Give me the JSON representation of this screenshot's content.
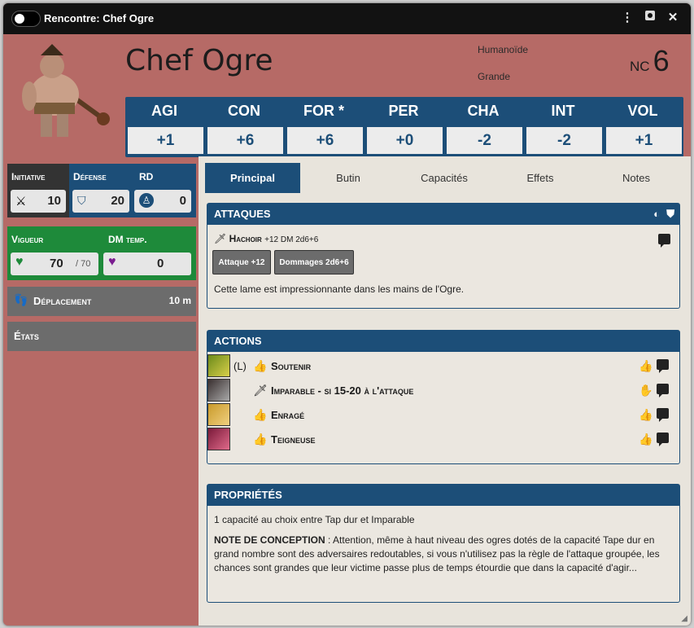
{
  "window": {
    "title": "Rencontre: Chef Ogre"
  },
  "header": {
    "name": "Chef Ogre",
    "type": "Humanoïde",
    "size": "Grande",
    "nc_label": "NC",
    "nc_value": "6"
  },
  "stats": [
    {
      "name": "AGI",
      "value": "+1"
    },
    {
      "name": "CON",
      "value": "+6"
    },
    {
      "name": "FOR *",
      "value": "+6"
    },
    {
      "name": "PER",
      "value": "+0"
    },
    {
      "name": "CHA",
      "value": "-2"
    },
    {
      "name": "INT",
      "value": "-2"
    },
    {
      "name": "VOL",
      "value": "+1"
    }
  ],
  "combat": {
    "initiative_label": "Initiative",
    "initiative": "10",
    "defense_label": "Défense",
    "defense": "20",
    "rd_label": "RD",
    "rd": "0",
    "vigueur_label": "Vigueur",
    "vigueur": "70",
    "vigueur_max": "/ 70",
    "dmtemp_label": "DM temp.",
    "dmtemp": "0",
    "deplacement_label": "Déplacement",
    "deplacement": "10 m",
    "etats_label": "États"
  },
  "tabs": [
    "Principal",
    "Butin",
    "Capacités",
    "Effets",
    "Notes"
  ],
  "attaques": {
    "title": "ATTAQUES",
    "weapon": "Hachoir",
    "weapon_stats": "+12 DM 2d6+6",
    "attack_button": "Attaque +12",
    "damage_button": "Dommages 2d6+6",
    "description": "Cette lame est impressionnante dans les mains de l'Ogre."
  },
  "actions": {
    "title": "ACTIONS",
    "items": [
      {
        "prefix": "(L)",
        "name": "Soutenir"
      },
      {
        "prefix": "",
        "name": "Imparable - si 15-20 à l'attaque"
      },
      {
        "prefix": "",
        "name": "Enragé"
      },
      {
        "prefix": "",
        "name": "Teigneuse"
      }
    ]
  },
  "proprietes": {
    "title": "PROPRIÉTÉS",
    "line1": "1 capacité au choix entre Tap dur et Imparable",
    "note_label": "NOTE DE CONCEPTION",
    "note_text": " : Attention, même à haut niveau des ogres dotés de la capacité Tape dur en grand nombre sont des adversaires redoutables, si vous n'utilisez pas la règle de l'attaque groupée, les chances sont grandes que leur victime passe plus de temps étourdie que dans la capacité d'agir..."
  },
  "colors": {
    "primary": "#1c4e78",
    "green": "#1e8a3a",
    "dark": "#121212",
    "bg": "#b66a66"
  }
}
